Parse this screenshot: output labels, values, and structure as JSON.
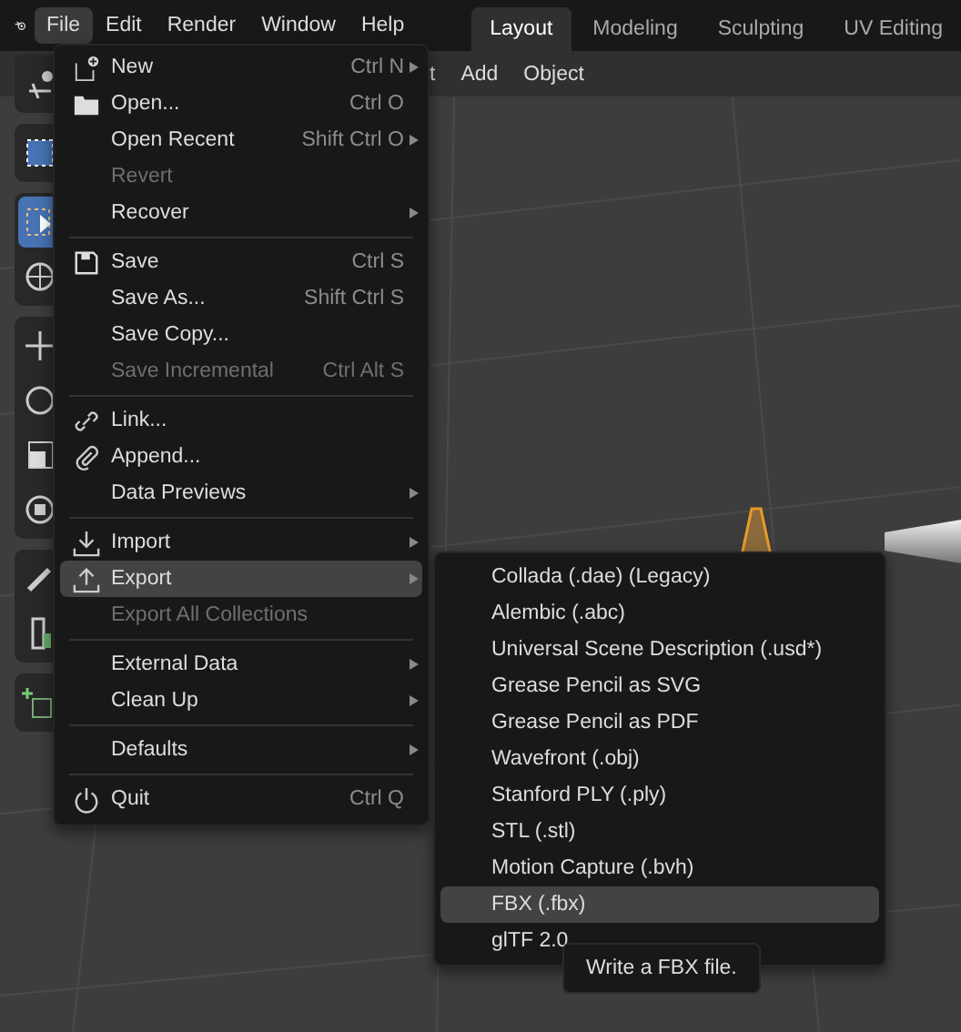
{
  "menubar": [
    {
      "label": "File",
      "selected": true
    },
    {
      "label": "Edit",
      "selected": false
    },
    {
      "label": "Render",
      "selected": false
    },
    {
      "label": "Window",
      "selected": false
    },
    {
      "label": "Help",
      "selected": false
    }
  ],
  "workspaces": [
    {
      "label": "Layout",
      "selected": true
    },
    {
      "label": "Modeling",
      "selected": false
    },
    {
      "label": "Sculpting",
      "selected": false
    },
    {
      "label": "UV Editing",
      "selected": false
    }
  ],
  "viewport_header": [
    "t",
    "Add",
    "Object"
  ],
  "file_menu": [
    {
      "kind": "item",
      "label": "New",
      "shortcut": "Ctrl N",
      "submenu": true,
      "disabled": false,
      "selected": false
    },
    {
      "kind": "item",
      "label": "Open...",
      "shortcut": "Ctrl O",
      "submenu": false,
      "disabled": false,
      "selected": false
    },
    {
      "kind": "item",
      "label": "Open Recent",
      "shortcut": "Shift Ctrl O",
      "submenu": true,
      "disabled": false,
      "selected": false
    },
    {
      "kind": "item",
      "label": "Revert",
      "submenu": false,
      "disabled": true,
      "selected": false
    },
    {
      "kind": "item",
      "label": "Recover",
      "submenu": true,
      "disabled": false,
      "selected": false
    },
    {
      "kind": "separator"
    },
    {
      "kind": "item",
      "label": "Save",
      "shortcut": "Ctrl S",
      "submenu": false,
      "disabled": false,
      "selected": false
    },
    {
      "kind": "item",
      "label": "Save As...",
      "shortcut": "Shift Ctrl S",
      "submenu": false,
      "disabled": false,
      "selected": false
    },
    {
      "kind": "item",
      "label": "Save Copy...",
      "submenu": false,
      "disabled": false,
      "selected": false
    },
    {
      "kind": "item",
      "label": "Save Incremental",
      "shortcut": "Ctrl Alt S",
      "submenu": false,
      "disabled": true,
      "selected": false
    },
    {
      "kind": "separator"
    },
    {
      "kind": "item",
      "label": "Link...",
      "submenu": false,
      "disabled": false,
      "selected": false
    },
    {
      "kind": "item",
      "label": "Append...",
      "submenu": false,
      "disabled": false,
      "selected": false
    },
    {
      "kind": "item",
      "label": "Data Previews",
      "submenu": true,
      "disabled": false,
      "selected": false
    },
    {
      "kind": "separator"
    },
    {
      "kind": "item",
      "label": "Import",
      "submenu": true,
      "disabled": false,
      "selected": false
    },
    {
      "kind": "item",
      "label": "Export",
      "submenu": true,
      "disabled": false,
      "selected": true
    },
    {
      "kind": "item",
      "label": "Export All Collections",
      "submenu": false,
      "disabled": true,
      "selected": false
    },
    {
      "kind": "separator"
    },
    {
      "kind": "item",
      "label": "External Data",
      "submenu": true,
      "disabled": false,
      "selected": false
    },
    {
      "kind": "item",
      "label": "Clean Up",
      "submenu": true,
      "disabled": false,
      "selected": false
    },
    {
      "kind": "separator"
    },
    {
      "kind": "item",
      "label": "Defaults",
      "submenu": true,
      "disabled": false,
      "selected": false
    },
    {
      "kind": "separator"
    },
    {
      "kind": "item",
      "label": "Quit",
      "shortcut": "Ctrl Q",
      "submenu": false,
      "disabled": false,
      "selected": false
    }
  ],
  "export_menu": [
    {
      "label": "Collada (.dae) (Legacy)",
      "selected": false
    },
    {
      "label": "Alembic (.abc)",
      "selected": false
    },
    {
      "label": "Universal Scene Description (.usd*)",
      "selected": false
    },
    {
      "label": "Grease Pencil as SVG",
      "selected": false
    },
    {
      "label": "Grease Pencil as PDF",
      "selected": false
    },
    {
      "label": "Wavefront (.obj)",
      "selected": false
    },
    {
      "label": "Stanford PLY (.ply)",
      "selected": false
    },
    {
      "label": "STL (.stl)",
      "selected": false
    },
    {
      "label": "Motion Capture (.bvh)",
      "selected": false
    },
    {
      "label": "FBX (.fbx)",
      "selected": true
    },
    {
      "label": "glTF 2.0",
      "selected": false
    }
  ],
  "tooltip": "Write a FBX file."
}
